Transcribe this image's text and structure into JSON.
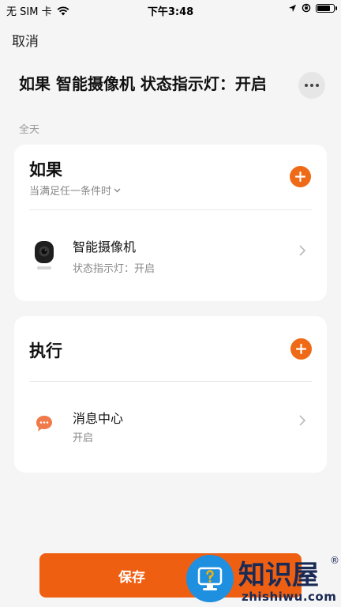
{
  "status_bar": {
    "carrier": "无 SIM 卡",
    "time": "下午3:48",
    "battery_level": 0.85
  },
  "header": {
    "cancel_label": "取消",
    "title": "如果 智能摄像机 状态指示灯：开启",
    "subtitle": "全天"
  },
  "if_section": {
    "heading": "如果",
    "condition_mode": "当满足任一条件时",
    "items": [
      {
        "title": "智能摄像机",
        "subtitle": "状态指示灯：开启",
        "icon": "camera-icon"
      }
    ]
  },
  "do_section": {
    "heading": "执行",
    "items": [
      {
        "title": "消息中心",
        "subtitle": "开启",
        "icon": "message-bubble-icon"
      }
    ]
  },
  "save_label": "保存",
  "watermark": {
    "name": "知识屋",
    "url": "zhishiwu.com"
  },
  "colors": {
    "accent": "#ef6a16",
    "background": "#f5f5f5",
    "card": "#ffffff"
  }
}
